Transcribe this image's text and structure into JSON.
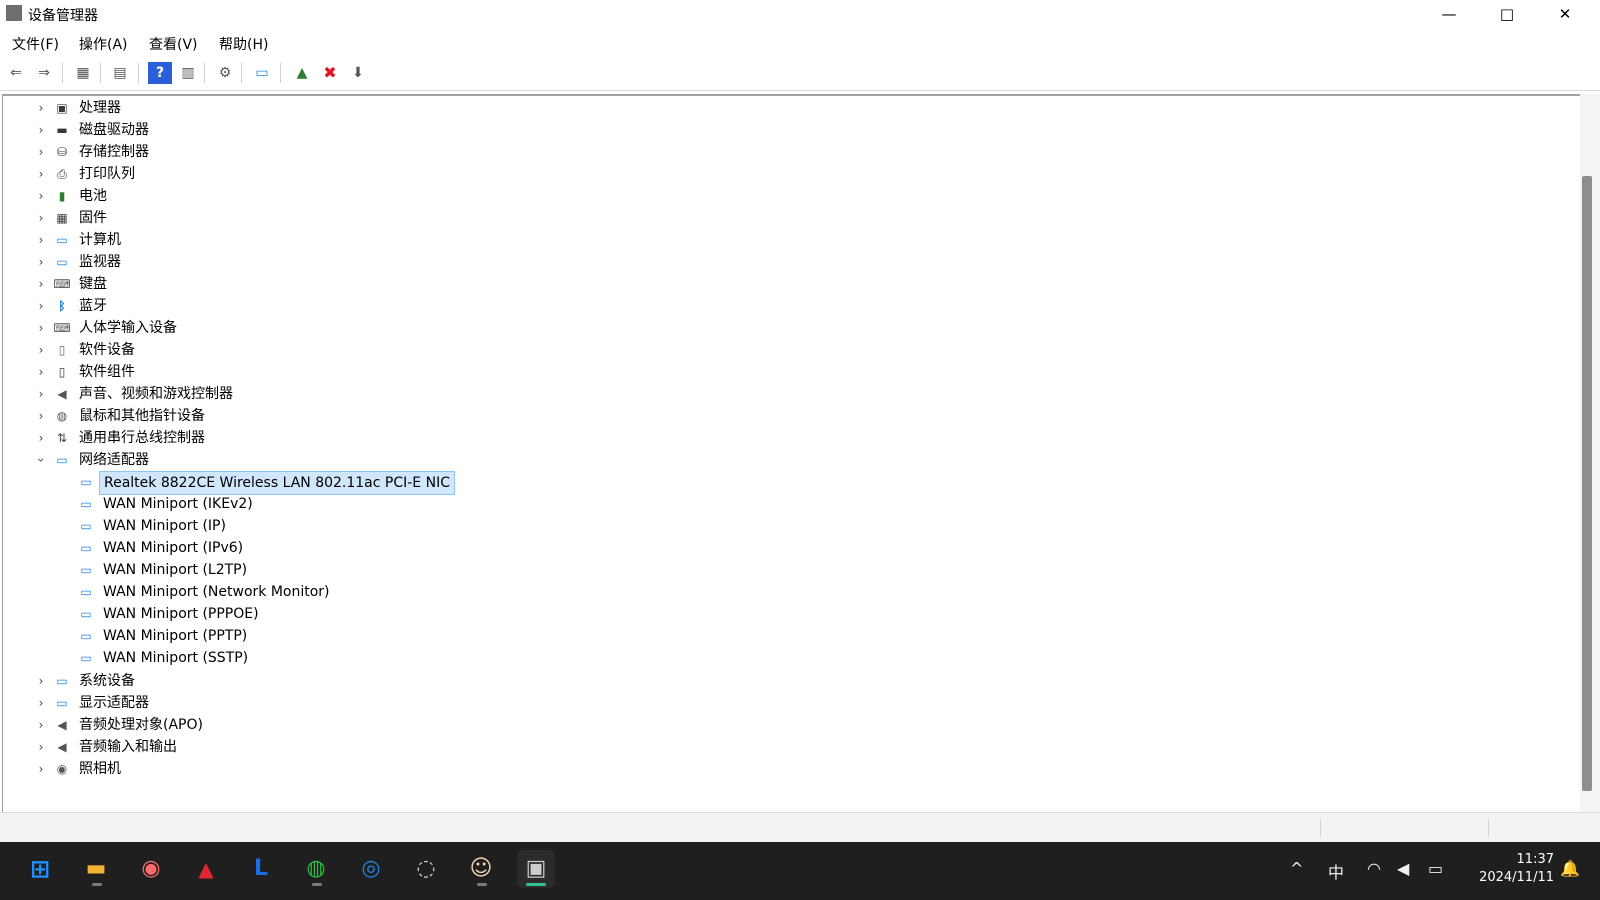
{
  "window": {
    "title": "设备管理器",
    "app_icon": "device-manager-icon",
    "buttons": {
      "minimize": "—",
      "maximize": "□",
      "close": "✕"
    }
  },
  "menubar": {
    "items": [
      {
        "label": "文件(F)"
      },
      {
        "label": "操作(A)"
      },
      {
        "label": "查看(V)"
      },
      {
        "label": "帮助(H)"
      }
    ]
  },
  "toolbar": {
    "buttons": [
      {
        "icon": "back-arrow-icon",
        "glyph": "⇐"
      },
      {
        "icon": "forward-arrow-icon",
        "glyph": "⇒"
      },
      {
        "icon": "show-hide-console-tree-icon",
        "glyph": "▦"
      },
      {
        "icon": "properties-icon",
        "glyph": "▤"
      },
      {
        "icon": "help-icon",
        "glyph": "?"
      },
      {
        "icon": "action-pane-icon",
        "glyph": "▥"
      },
      {
        "icon": "update-driver-icon",
        "glyph": "⚙"
      },
      {
        "icon": "scan-hardware-changes-icon",
        "glyph": "▭"
      },
      {
        "icon": "enable-device-icon",
        "glyph": "▲"
      },
      {
        "icon": "uninstall-device-icon",
        "glyph": "✖",
        "color": "#e81123"
      },
      {
        "icon": "disable-device-icon",
        "glyph": "⬇"
      }
    ]
  },
  "tree": {
    "categories": [
      {
        "label": "处理器",
        "icon": "processor-icon",
        "glyph": "▣",
        "color": "#3a3a3a",
        "expanded": false
      },
      {
        "label": "磁盘驱动器",
        "icon": "disk-drive-icon",
        "glyph": "▬",
        "color": "#3a3a3a",
        "expanded": false
      },
      {
        "label": "存储控制器",
        "icon": "storage-controller-icon",
        "glyph": "⛁",
        "color": "#3a3a3a",
        "expanded": false
      },
      {
        "label": "打印队列",
        "icon": "printer-icon",
        "glyph": "⎙",
        "color": "#3a3a3a",
        "expanded": false
      },
      {
        "label": "电池",
        "icon": "battery-icon",
        "glyph": "▮",
        "color": "#2e7d32",
        "expanded": false
      },
      {
        "label": "固件",
        "icon": "firmware-icon",
        "glyph": "▦",
        "color": "#3a3a3a",
        "expanded": false
      },
      {
        "label": "计算机",
        "icon": "computer-icon",
        "glyph": "▭",
        "color": "#1e88e5",
        "expanded": false
      },
      {
        "label": "监视器",
        "icon": "monitor-icon",
        "glyph": "▭",
        "color": "#1e88e5",
        "expanded": false
      },
      {
        "label": "键盘",
        "icon": "keyboard-icon",
        "glyph": "⌨",
        "color": "#555555",
        "expanded": false
      },
      {
        "label": "蓝牙",
        "icon": "bluetooth-icon",
        "glyph": "ᛒ",
        "color": "#0b7de0",
        "expanded": false
      },
      {
        "label": "人体学输入设备",
        "icon": "human-interface-device-icon",
        "glyph": "⌨",
        "color": "#555555",
        "expanded": false
      },
      {
        "label": "软件设备",
        "icon": "software-device-icon",
        "glyph": "▯",
        "color": "#666666",
        "expanded": false
      },
      {
        "label": "软件组件",
        "icon": "software-component-icon",
        "glyph": "▯",
        "color": "#3a3a3a",
        "expanded": false
      },
      {
        "label": "声音、视频和游戏控制器",
        "icon": "speaker-icon",
        "glyph": "◀",
        "color": "#555555",
        "expanded": false
      },
      {
        "label": "鼠标和其他指针设备",
        "icon": "mouse-icon",
        "glyph": "◍",
        "color": "#555555",
        "expanded": false
      },
      {
        "label": "通用串行总线控制器",
        "icon": "usb-icon",
        "glyph": "⇅",
        "color": "#444444",
        "expanded": false
      },
      {
        "label": "网络适配器",
        "icon": "network-adapter-icon",
        "glyph": "▭",
        "color": "#1e88e5",
        "expanded": true,
        "children": [
          {
            "label": "Realtek 8822CE Wireless LAN 802.11ac PCI-E NIC",
            "selected": true
          },
          {
            "label": "WAN Miniport (IKEv2)"
          },
          {
            "label": "WAN Miniport (IP)"
          },
          {
            "label": "WAN Miniport (IPv6)"
          },
          {
            "label": "WAN Miniport (L2TP)"
          },
          {
            "label": "WAN Miniport (Network Monitor)"
          },
          {
            "label": "WAN Miniport (PPPOE)"
          },
          {
            "label": "WAN Miniport (PPTP)"
          },
          {
            "label": "WAN Miniport (SSTP)"
          }
        ]
      },
      {
        "label": "系统设备",
        "icon": "system-device-icon",
        "glyph": "▭",
        "color": "#1e88e5",
        "expanded": false
      },
      {
        "label": "显示适配器",
        "icon": "display-adapter-icon",
        "glyph": "▭",
        "color": "#1e88e5",
        "expanded": false
      },
      {
        "label": "音频处理对象(APO)",
        "icon": "audio-processing-icon",
        "glyph": "◀",
        "color": "#555555",
        "expanded": false
      },
      {
        "label": "音频输入和输出",
        "icon": "audio-io-icon",
        "glyph": "◀",
        "color": "#555555",
        "expanded": false
      },
      {
        "label": "照相机",
        "icon": "camera-icon",
        "glyph": "◉",
        "color": "#555555",
        "expanded": false
      }
    ]
  },
  "taskbar": {
    "apps": [
      {
        "icon": "windows-start-icon",
        "glyph": "⊞",
        "color": "#1e90ff"
      },
      {
        "icon": "file-explorer-icon",
        "glyph": "▬",
        "color": "#f2b233"
      },
      {
        "icon": "color-app-icon",
        "glyph": "◉",
        "color": "#ff6b6b"
      },
      {
        "icon": "amd-software-icon",
        "glyph": "▲",
        "color": "#e0262f"
      },
      {
        "icon": "shield-app-icon",
        "glyph": "L",
        "color": "#1e6de5"
      },
      {
        "icon": "wechat-icon",
        "glyph": "◍",
        "color": "#27c03f"
      },
      {
        "icon": "chat-bot-icon",
        "glyph": "◎",
        "color": "#1e88e5"
      },
      {
        "icon": "obs-studio-icon",
        "glyph": "◌",
        "color": "#cfcfcf"
      },
      {
        "icon": "anime-app-icon",
        "glyph": "☺",
        "color": "#f5d2b0"
      },
      {
        "icon": "device-manager-taskbar-icon",
        "glyph": "▣",
        "color": "#cccccc"
      }
    ],
    "tray": {
      "chevron": "^",
      "ime": "中",
      "wifi": "wifi-icon",
      "volume": "volume-icon",
      "battery": "battery-icon",
      "time": "11:37",
      "date": "2024/11/11",
      "notification": "bell-icon"
    }
  }
}
